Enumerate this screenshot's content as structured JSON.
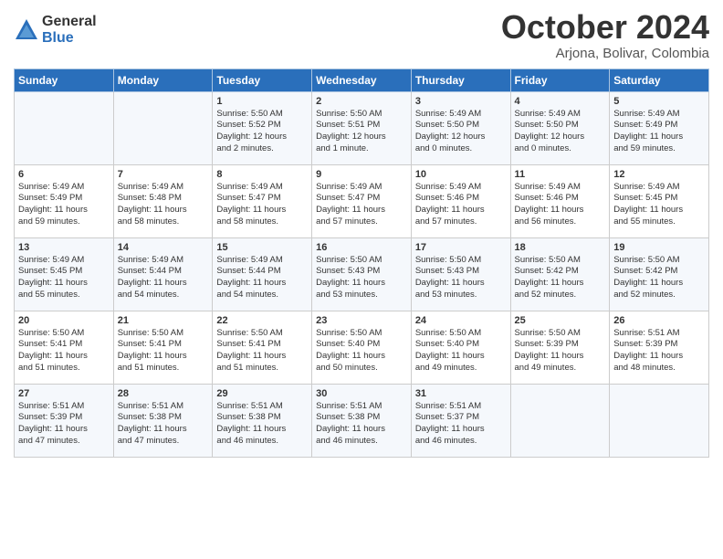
{
  "logo": {
    "general": "General",
    "blue": "Blue"
  },
  "title": "October 2024",
  "location": "Arjona, Bolivar, Colombia",
  "weekdays": [
    "Sunday",
    "Monday",
    "Tuesday",
    "Wednesday",
    "Thursday",
    "Friday",
    "Saturday"
  ],
  "weeks": [
    [
      {
        "day": "",
        "info": ""
      },
      {
        "day": "",
        "info": ""
      },
      {
        "day": "1",
        "info": "Sunrise: 5:50 AM\nSunset: 5:52 PM\nDaylight: 12 hours\nand 2 minutes."
      },
      {
        "day": "2",
        "info": "Sunrise: 5:50 AM\nSunset: 5:51 PM\nDaylight: 12 hours\nand 1 minute."
      },
      {
        "day": "3",
        "info": "Sunrise: 5:49 AM\nSunset: 5:50 PM\nDaylight: 12 hours\nand 0 minutes."
      },
      {
        "day": "4",
        "info": "Sunrise: 5:49 AM\nSunset: 5:50 PM\nDaylight: 12 hours\nand 0 minutes."
      },
      {
        "day": "5",
        "info": "Sunrise: 5:49 AM\nSunset: 5:49 PM\nDaylight: 11 hours\nand 59 minutes."
      }
    ],
    [
      {
        "day": "6",
        "info": "Sunrise: 5:49 AM\nSunset: 5:49 PM\nDaylight: 11 hours\nand 59 minutes."
      },
      {
        "day": "7",
        "info": "Sunrise: 5:49 AM\nSunset: 5:48 PM\nDaylight: 11 hours\nand 58 minutes."
      },
      {
        "day": "8",
        "info": "Sunrise: 5:49 AM\nSunset: 5:47 PM\nDaylight: 11 hours\nand 58 minutes."
      },
      {
        "day": "9",
        "info": "Sunrise: 5:49 AM\nSunset: 5:47 PM\nDaylight: 11 hours\nand 57 minutes."
      },
      {
        "day": "10",
        "info": "Sunrise: 5:49 AM\nSunset: 5:46 PM\nDaylight: 11 hours\nand 57 minutes."
      },
      {
        "day": "11",
        "info": "Sunrise: 5:49 AM\nSunset: 5:46 PM\nDaylight: 11 hours\nand 56 minutes."
      },
      {
        "day": "12",
        "info": "Sunrise: 5:49 AM\nSunset: 5:45 PM\nDaylight: 11 hours\nand 55 minutes."
      }
    ],
    [
      {
        "day": "13",
        "info": "Sunrise: 5:49 AM\nSunset: 5:45 PM\nDaylight: 11 hours\nand 55 minutes."
      },
      {
        "day": "14",
        "info": "Sunrise: 5:49 AM\nSunset: 5:44 PM\nDaylight: 11 hours\nand 54 minutes."
      },
      {
        "day": "15",
        "info": "Sunrise: 5:49 AM\nSunset: 5:44 PM\nDaylight: 11 hours\nand 54 minutes."
      },
      {
        "day": "16",
        "info": "Sunrise: 5:50 AM\nSunset: 5:43 PM\nDaylight: 11 hours\nand 53 minutes."
      },
      {
        "day": "17",
        "info": "Sunrise: 5:50 AM\nSunset: 5:43 PM\nDaylight: 11 hours\nand 53 minutes."
      },
      {
        "day": "18",
        "info": "Sunrise: 5:50 AM\nSunset: 5:42 PM\nDaylight: 11 hours\nand 52 minutes."
      },
      {
        "day": "19",
        "info": "Sunrise: 5:50 AM\nSunset: 5:42 PM\nDaylight: 11 hours\nand 52 minutes."
      }
    ],
    [
      {
        "day": "20",
        "info": "Sunrise: 5:50 AM\nSunset: 5:41 PM\nDaylight: 11 hours\nand 51 minutes."
      },
      {
        "day": "21",
        "info": "Sunrise: 5:50 AM\nSunset: 5:41 PM\nDaylight: 11 hours\nand 51 minutes."
      },
      {
        "day": "22",
        "info": "Sunrise: 5:50 AM\nSunset: 5:41 PM\nDaylight: 11 hours\nand 51 minutes."
      },
      {
        "day": "23",
        "info": "Sunrise: 5:50 AM\nSunset: 5:40 PM\nDaylight: 11 hours\nand 50 minutes."
      },
      {
        "day": "24",
        "info": "Sunrise: 5:50 AM\nSunset: 5:40 PM\nDaylight: 11 hours\nand 49 minutes."
      },
      {
        "day": "25",
        "info": "Sunrise: 5:50 AM\nSunset: 5:39 PM\nDaylight: 11 hours\nand 49 minutes."
      },
      {
        "day": "26",
        "info": "Sunrise: 5:51 AM\nSunset: 5:39 PM\nDaylight: 11 hours\nand 48 minutes."
      }
    ],
    [
      {
        "day": "27",
        "info": "Sunrise: 5:51 AM\nSunset: 5:39 PM\nDaylight: 11 hours\nand 47 minutes."
      },
      {
        "day": "28",
        "info": "Sunrise: 5:51 AM\nSunset: 5:38 PM\nDaylight: 11 hours\nand 47 minutes."
      },
      {
        "day": "29",
        "info": "Sunrise: 5:51 AM\nSunset: 5:38 PM\nDaylight: 11 hours\nand 46 minutes."
      },
      {
        "day": "30",
        "info": "Sunrise: 5:51 AM\nSunset: 5:38 PM\nDaylight: 11 hours\nand 46 minutes."
      },
      {
        "day": "31",
        "info": "Sunrise: 5:51 AM\nSunset: 5:37 PM\nDaylight: 11 hours\nand 46 minutes."
      },
      {
        "day": "",
        "info": ""
      },
      {
        "day": "",
        "info": ""
      }
    ]
  ]
}
